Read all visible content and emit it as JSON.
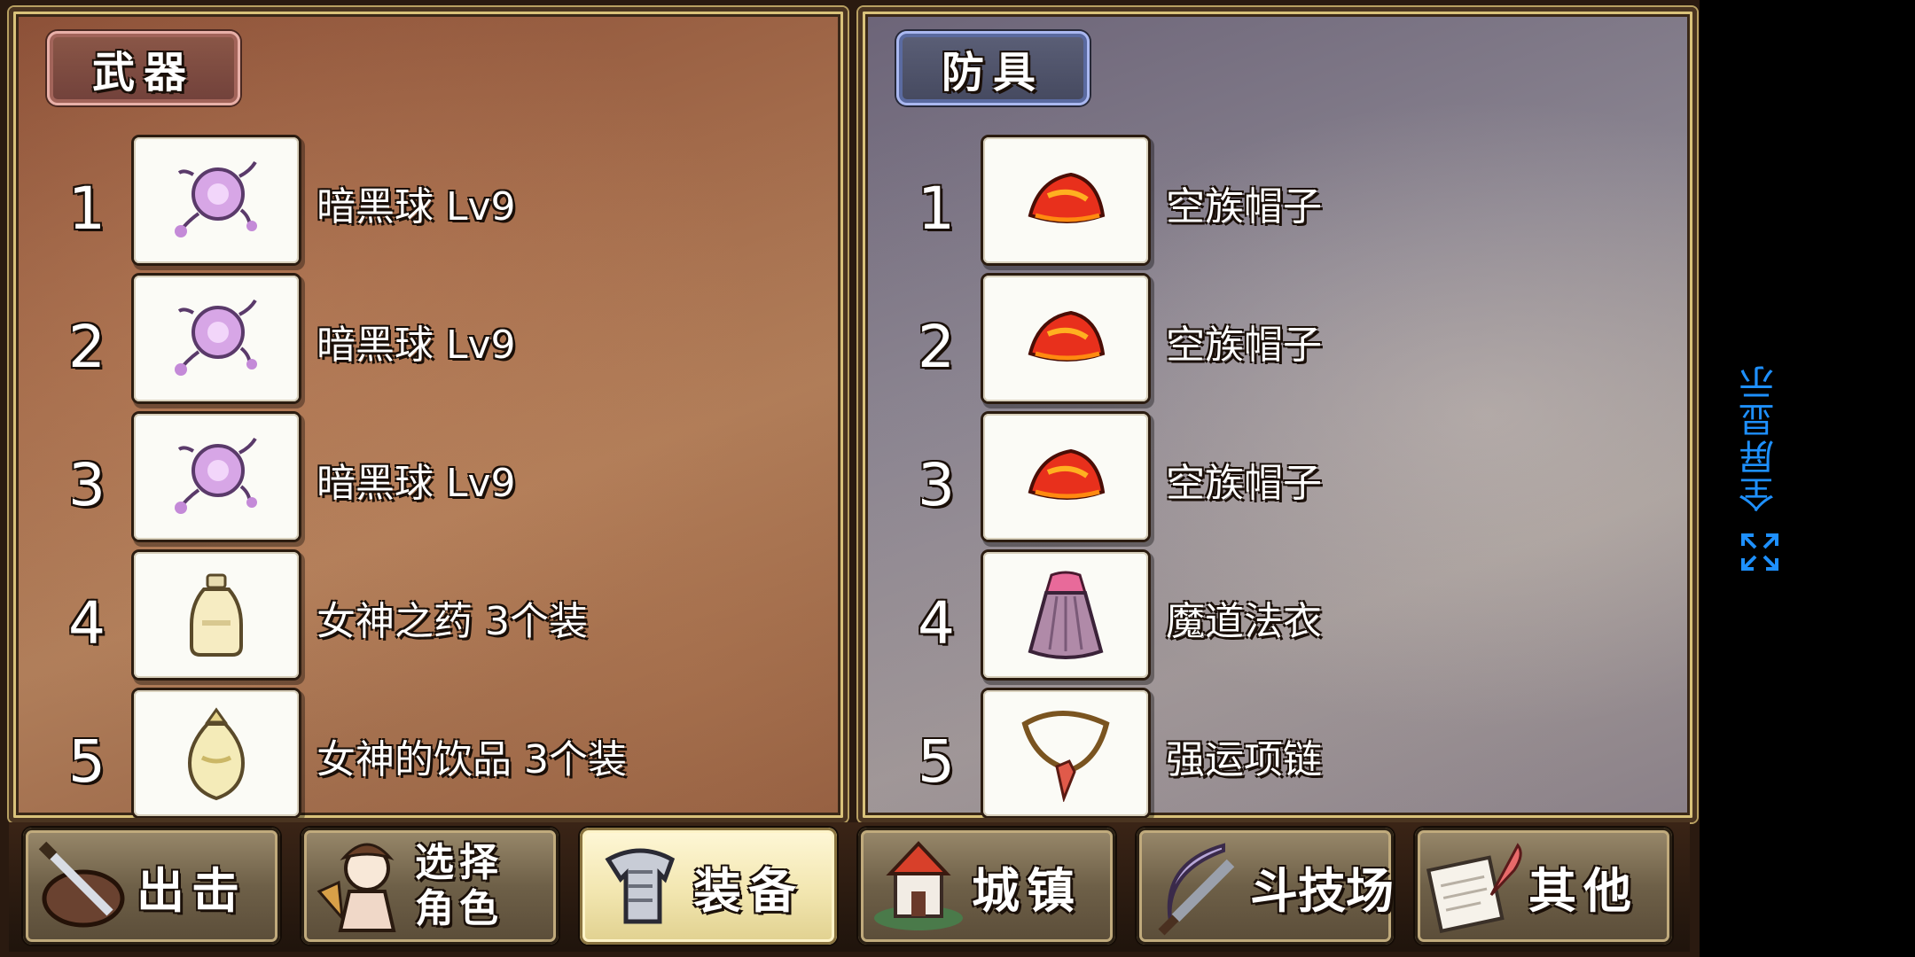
{
  "weapon_panel": {
    "title": "武器",
    "slots": [
      {
        "num": "1",
        "name": "暗黑球 Lv9",
        "icon": "dark-orb-icon"
      },
      {
        "num": "2",
        "name": "暗黑球 Lv9",
        "icon": "dark-orb-icon"
      },
      {
        "num": "3",
        "name": "暗黑球 Lv9",
        "icon": "dark-orb-icon"
      },
      {
        "num": "4",
        "name": "女神之药 3个装",
        "icon": "potion-bottle-icon"
      },
      {
        "num": "5",
        "name": "女神的饮品 3个装",
        "icon": "drink-flask-icon"
      }
    ]
  },
  "armor_panel": {
    "title": "防具",
    "slots": [
      {
        "num": "1",
        "name": "空族帽子",
        "icon": "red-hat-icon"
      },
      {
        "num": "2",
        "name": "空族帽子",
        "icon": "red-hat-icon"
      },
      {
        "num": "3",
        "name": "空族帽子",
        "icon": "red-hat-icon"
      },
      {
        "num": "4",
        "name": "魔道法衣",
        "icon": "magic-robe-icon"
      },
      {
        "num": "5",
        "name": "强运项链",
        "icon": "lucky-necklace-icon"
      }
    ]
  },
  "menu": {
    "sortie": "出击",
    "select_line1": "选择",
    "select_line2": "角色",
    "equip": "装备",
    "town": "城镇",
    "arena": "斗技场",
    "other": "其他"
  },
  "system": {
    "fullscreen_label": "全屏显示"
  },
  "colors": {
    "accent_blue": "#1e90ff",
    "active_tab": "#f2e6b0"
  }
}
